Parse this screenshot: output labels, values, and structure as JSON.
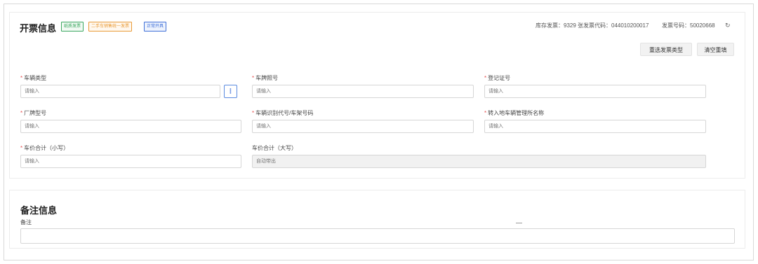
{
  "invoice": {
    "title": "开票信息",
    "tags": [
      "纸质发票",
      "二手车销售统一发票",
      "正常开具"
    ],
    "stock_label": "库存发票：9329 张",
    "code_label": "发票代码：044010200017",
    "number_label": "发票号码：50020668",
    "buttons": {
      "reselect": "重选发票类型",
      "clear": "清空重填"
    }
  },
  "form": {
    "required_mark": "*",
    "vehicle_type": {
      "label": "车辆类型",
      "placeholder": "请输入"
    },
    "plate_no": {
      "label": "车牌照号",
      "placeholder": "请输入"
    },
    "reg_cert_no": {
      "label": "登记证号",
      "placeholder": "请输入"
    },
    "model_no": {
      "label": "厂牌型号",
      "placeholder": "请输入"
    },
    "vin": {
      "label": "车辆识别代号/车架号码",
      "placeholder": "请输入"
    },
    "dmv_name": {
      "label": "转入地车辆管理所名称",
      "placeholder": "请输入"
    },
    "price_small": {
      "label": "车价合计（小写）",
      "placeholder": "请输入"
    },
    "price_big": {
      "label": "车价合计（大写）",
      "placeholder": "自动带出"
    }
  },
  "remarks": {
    "title": "备注信息",
    "label": "备注",
    "value": ""
  },
  "colors": {
    "primary": "#3e6fd8",
    "required": "#e55252",
    "tag_green": "#3aa75f",
    "tag_orange": "#e99a36"
  },
  "icons": {
    "refresh": "refresh-icon",
    "more": "more-vertical-icon"
  }
}
